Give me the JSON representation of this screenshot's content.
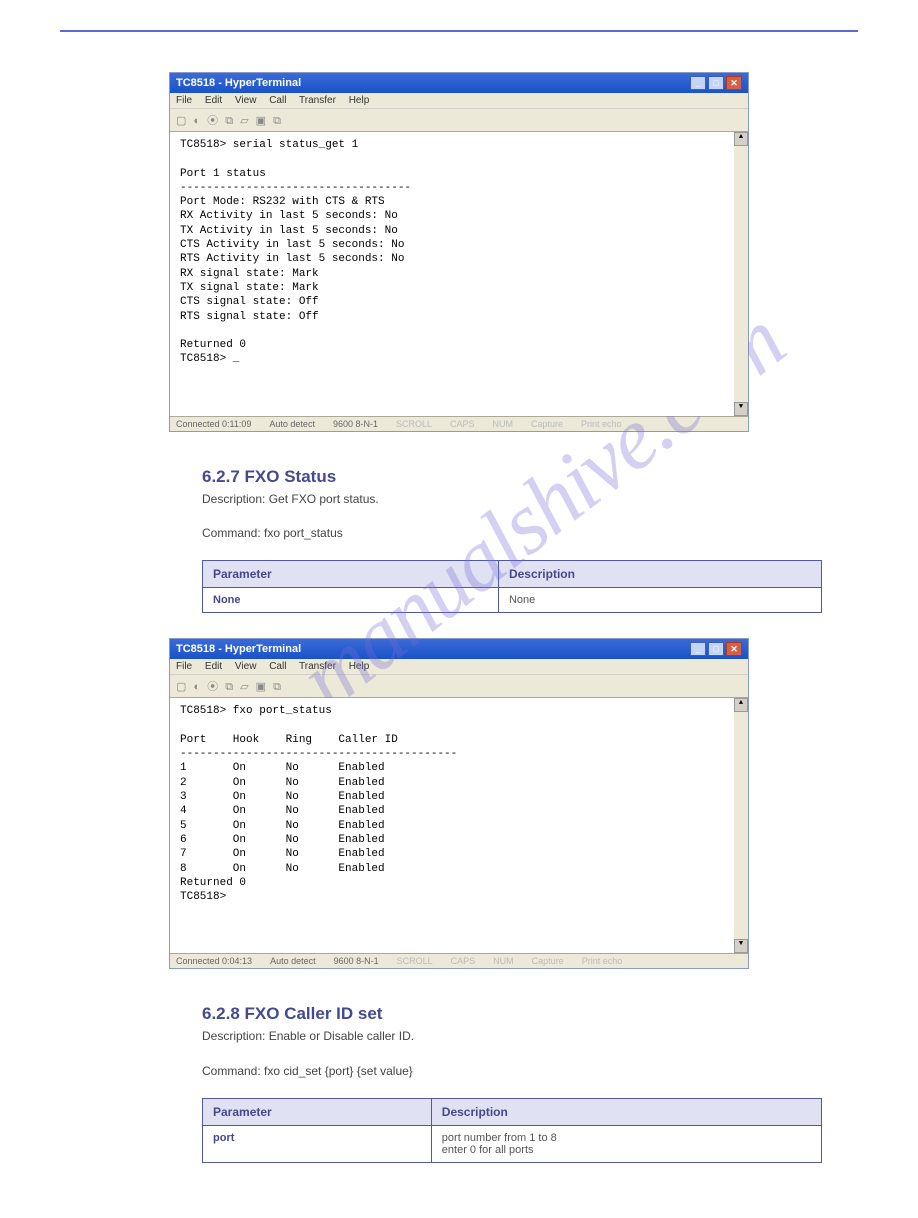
{
  "watermark": "manualshive.com",
  "terminal1": {
    "title": "TC8518 - HyperTerminal",
    "menu": [
      "File",
      "Edit",
      "View",
      "Call",
      "Transfer",
      "Help"
    ],
    "toolbar_glyphs": "▢ ◐  ⦿ ⧉  ▱ ▣ ⧉",
    "content": "TC8518> serial status_get 1\n\nPort 1 status\n-----------------------------------\nPort Mode: RS232 with CTS & RTS\nRX Activity in last 5 seconds: No\nTX Activity in last 5 seconds: No\nCTS Activity in last 5 seconds: No\nRTS Activity in last 5 seconds: No\nRX signal state: Mark\nTX signal state: Mark\nCTS signal state: Off\nRTS signal state: Off\n\nReturned 0\nTC8518> _",
    "status": {
      "connected": "Connected 0:11:09",
      "detect": "Auto detect",
      "baud": "9600 8-N-1",
      "flags": [
        "SCROLL",
        "CAPS",
        "NUM",
        "Capture",
        "Print echo"
      ]
    }
  },
  "section1": {
    "heading": "6.2.7  FXO Status",
    "sub": "Description: Get FXO port status.",
    "command_label": "Command",
    "command": "fxo port_status",
    "rows": [
      {
        "k": "Parameter",
        "v": "Description"
      },
      {
        "k": "None",
        "v": "None"
      }
    ]
  },
  "terminal2": {
    "title": "TC8518 - HyperTerminal",
    "menu": [
      "File",
      "Edit",
      "View",
      "Call",
      "Transfer",
      "Help"
    ],
    "toolbar_glyphs": "▢ ◐  ⦿ ⧉  ▱ ▣ ⧉",
    "content": "TC8518> fxo port_status\n\nPort    Hook    Ring    Caller ID\n------------------------------------------\n1       On      No      Enabled\n2       On      No      Enabled\n3       On      No      Enabled\n4       On      No      Enabled\n5       On      No      Enabled\n6       On      No      Enabled\n7       On      No      Enabled\n8       On      No      Enabled\nReturned 0\nTC8518>",
    "status": {
      "connected": "Connected 0:04:13",
      "detect": "Auto detect",
      "baud": "9600 8-N-1",
      "flags": [
        "SCROLL",
        "CAPS",
        "NUM",
        "Capture",
        "Print echo"
      ]
    }
  },
  "section2": {
    "heading": "6.2.8  FXO Caller ID set",
    "sub": "Description: Enable or Disable caller ID.",
    "command_label": "Command",
    "command": "fxo cid_set {port} {set value}",
    "rows": [
      {
        "k": "Parameter",
        "v": "Description"
      },
      {
        "k": "port",
        "v": "port number from 1 to 8\nenter 0 for all ports"
      }
    ]
  }
}
